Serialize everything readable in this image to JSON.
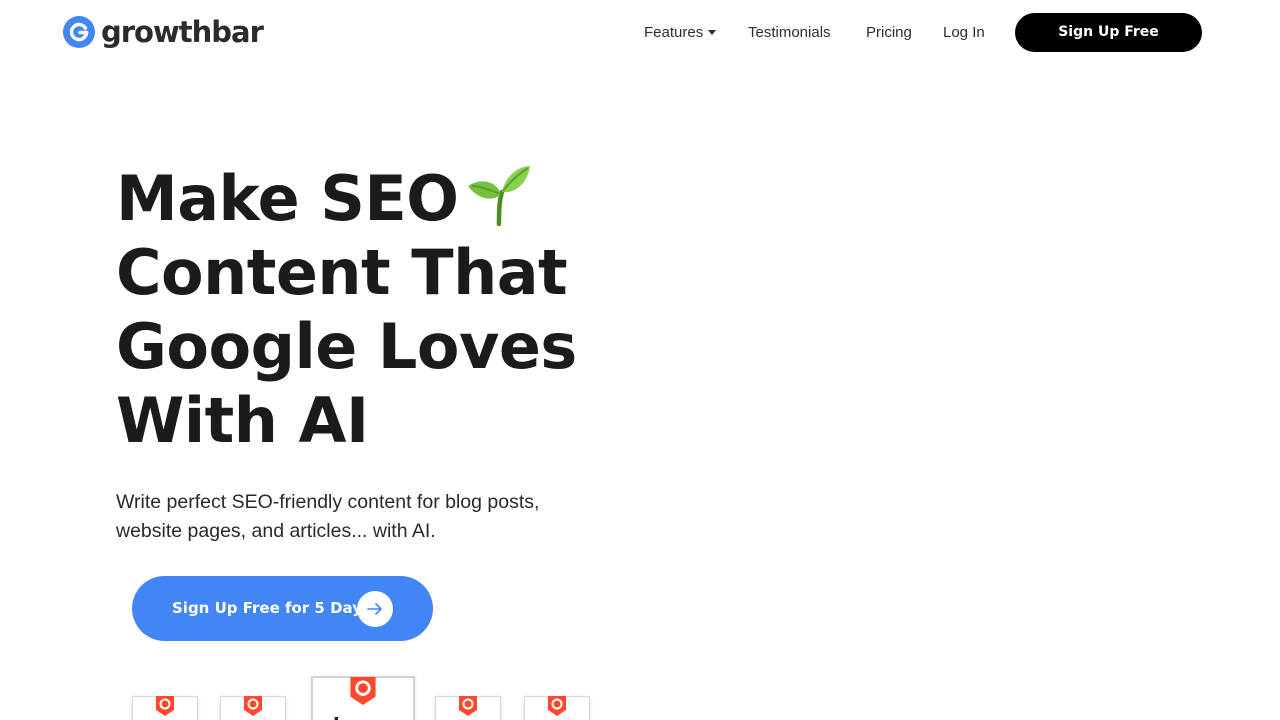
{
  "brand": {
    "name": "growthbar",
    "accent": "#4285f4",
    "logo_icon": "growthbar-g-icon"
  },
  "nav": {
    "features": "Features",
    "testimonials": "Testimonials",
    "pricing": "Pricing",
    "login": "Log In",
    "signup": "Sign Up Free"
  },
  "hero": {
    "title_lines": [
      "Make SEO",
      "Content That",
      "Google Loves",
      "With AI"
    ],
    "title_emoji": "seedling-icon",
    "subtitle": "Write perfect SEO-friendly content for blog posts, website pages, and articles... with AI.",
    "cta_label": "Sign Up Free for 5 Days",
    "cta_icon": "arrow-right-icon"
  },
  "badges": {
    "icon": "g2-badge-icon",
    "count": 5,
    "center_text": "L"
  }
}
